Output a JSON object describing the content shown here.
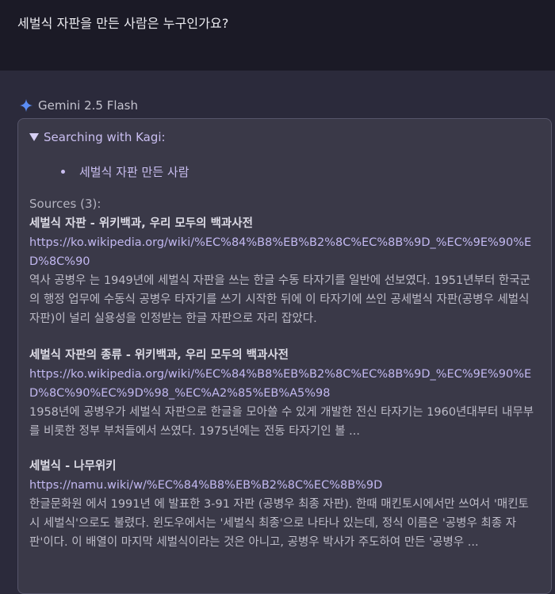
{
  "question": "세벌식 자판을 만든 사람은 누구인가요?",
  "model_name": "Gemini 2.5 Flash",
  "search": {
    "label": "Searching with Kagi:",
    "queries": [
      "세벌식 자판 만든 사람"
    ]
  },
  "sources_label": "Sources (3):",
  "sources": [
    {
      "title": "세벌식 자판 - 위키백과, 우리 모두의 백과사전",
      "url": "https://ko.wikipedia.org/wiki/%EC%84%B8%EB%B2%8C%EC%8B%9D_%EC%9E%90%ED%8C%90",
      "snippet": "역사 공병우 는 1949년에 세벌식 자판을 쓰는 한글 수동 타자기를 일반에 선보였다. 1951년부터 한국군의 행정 업무에 수동식 공병우 타자기를 쓰기 시작한 뒤에 이 타자기에 쓰인 공세벌식 자판(공병우 세벌식 자판)이 널리 실용성을 인정받는 한글 자판으로 자리 잡았다."
    },
    {
      "title": "세벌식 자판의 종류 - 위키백과, 우리 모두의 백과사전",
      "url": "https://ko.wikipedia.org/wiki/%EC%84%B8%EB%B2%8C%EC%8B%9D_%EC%9E%90%ED%8C%90%EC%9D%98_%EC%A2%85%EB%A5%98",
      "snippet": "1958년에 공병우가 세벌식 자판으로 한글을 모아쓸 수 있게 개발한 전신 타자기는 1960년대부터 내무부를 비롯한 정부 부처들에서 쓰였다. 1975년에는 전동 타자기인 볼 ..."
    },
    {
      "title": "세벌식 - 나무위키",
      "url": "https://namu.wiki/w/%EC%84%B8%EB%B2%8C%EC%8B%9D",
      "snippet": "한글문화원 에서 1991년 에 발표한 3-91 자판 (공병우 최종 자판). 한때 매킨토시에서만 쓰여서 '매킨토시 세벌식'으로도 불렸다. 윈도우에서는 '세벌식 최종'으로 나타나 있는데, 정식 이름은 '공병우 최종 자판'이다. 이 배열이 마지막 세벌식이라는 것은 아니고, 공병우 박사가 주도하여 만든 '공병우 ..."
    }
  ],
  "colors": {
    "accent_sparkle": "#5b8df5",
    "link": "#c2b8f0"
  }
}
